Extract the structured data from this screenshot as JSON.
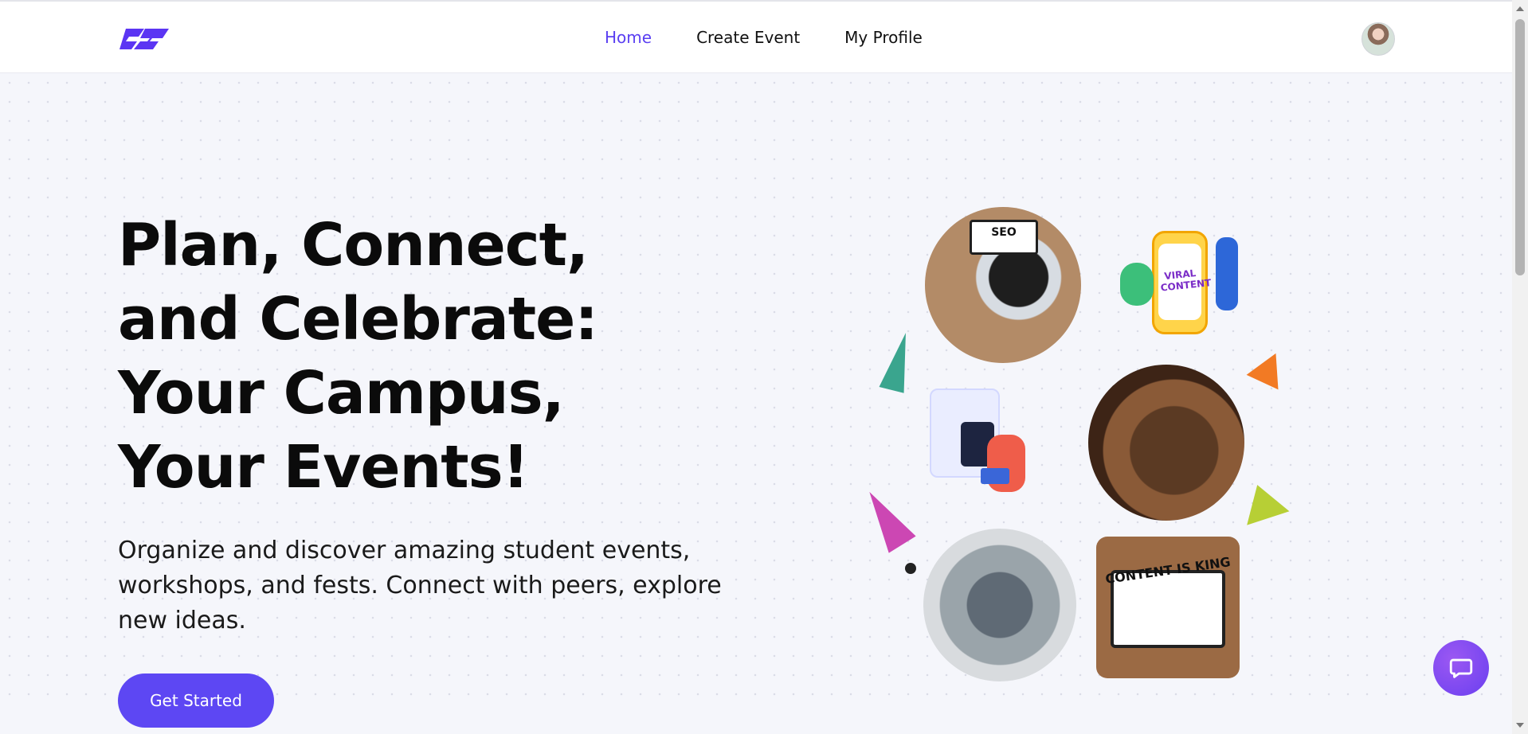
{
  "nav": {
    "links": [
      "Home",
      "Create Event",
      "My Profile"
    ],
    "active_link": "Home",
    "logo": "brand-logo",
    "avatar": "user-avatar"
  },
  "hero": {
    "title": "Plan, Connect, and Celebrate: Your Campus, Your Events!",
    "subtitle": "Organize and discover amazing student events, workshops, and fests. Connect with peers, explore new ideas.",
    "cta_label": "Get Started"
  },
  "collage": {
    "laptop_caption": "SEO",
    "viral_caption": "VIRAL CONTENT",
    "tablet_caption": "CONTENT IS KING"
  },
  "icons": {
    "chat": "chat-bubble-icon",
    "scroll_up": "chevron-up-icon",
    "scroll_down": "chevron-down-icon"
  },
  "colors": {
    "accent": "#5d47f3",
    "active_link": "#5a3ff2",
    "background": "#f5f6fb"
  }
}
